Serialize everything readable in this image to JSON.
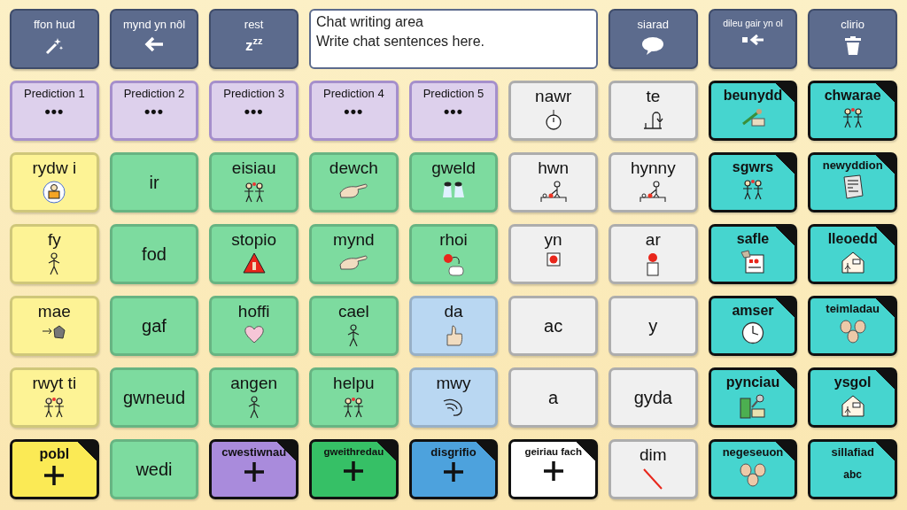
{
  "toolbar_left": [
    {
      "label": "ffon hud"
    },
    {
      "label": "mynd yn nôl"
    },
    {
      "label": "rest",
      "symbol": "z$^{z}$$^{z}$"
    }
  ],
  "chat": {
    "title": "Chat writing area",
    "placeholder": "Write chat sentences here."
  },
  "toolbar_right": [
    {
      "label": "siarad"
    },
    {
      "label": "dileu gair yn ol"
    },
    {
      "label": "clirio"
    }
  ],
  "grid": [
    [
      {
        "label": "Prediction 1",
        "kind": "prediction",
        "sub": "•••",
        "color": "#ddd0ec"
      },
      {
        "label": "Prediction 2",
        "kind": "prediction",
        "sub": "•••",
        "color": "#ddd0ec"
      },
      {
        "label": "Prediction 3",
        "kind": "prediction",
        "sub": "•••",
        "color": "#ddd0ec"
      },
      {
        "label": "Prediction 4",
        "kind": "prediction",
        "sub": "•••",
        "color": "#ddd0ec"
      },
      {
        "label": "Prediction 5",
        "kind": "prediction",
        "sub": "•••",
        "color": "#ddd0ec"
      },
      {
        "label": "nawr",
        "kind": "word",
        "color": "#f0f0f0"
      },
      {
        "label": "te",
        "kind": "word",
        "color": "#f0f0f0"
      },
      {
        "label": "beunydd",
        "kind": "folder",
        "color": "#46d5cf"
      },
      {
        "label": "chwarae",
        "kind": "folder",
        "color": "#46d5cf"
      }
    ],
    [
      {
        "label": "rydw i",
        "kind": "word",
        "color": "#fdf395"
      },
      {
        "label": "ir",
        "kind": "word",
        "color": "#7ddb9f"
      },
      {
        "label": "eisiau",
        "kind": "word",
        "color": "#7ddb9f"
      },
      {
        "label": "dewch",
        "kind": "word",
        "color": "#7ddb9f"
      },
      {
        "label": "gweld",
        "kind": "word",
        "color": "#7ddb9f"
      },
      {
        "label": "hwn",
        "kind": "word",
        "color": "#f0f0f0"
      },
      {
        "label": "hynny",
        "kind": "word",
        "color": "#f0f0f0"
      },
      {
        "label": "sgwrs",
        "kind": "folder",
        "color": "#46d5cf"
      },
      {
        "label": "newyddion",
        "kind": "folder",
        "color": "#46d5cf"
      }
    ],
    [
      {
        "label": "fy",
        "kind": "word",
        "color": "#fdf395"
      },
      {
        "label": "fod",
        "kind": "word",
        "color": "#7ddb9f"
      },
      {
        "label": "stopio",
        "kind": "word",
        "color": "#7ddb9f"
      },
      {
        "label": "mynd",
        "kind": "word",
        "color": "#7ddb9f"
      },
      {
        "label": "rhoi",
        "kind": "word",
        "color": "#7ddb9f"
      },
      {
        "label": "yn",
        "kind": "word",
        "color": "#f0f0f0"
      },
      {
        "label": "ar",
        "kind": "word",
        "color": "#f0f0f0"
      },
      {
        "label": "safle",
        "kind": "folder",
        "color": "#46d5cf"
      },
      {
        "label": "lleoedd",
        "kind": "folder",
        "color": "#46d5cf"
      }
    ],
    [
      {
        "label": "mae",
        "kind": "word",
        "color": "#fdf395"
      },
      {
        "label": "gaf",
        "kind": "word",
        "color": "#7ddb9f"
      },
      {
        "label": "hoffi",
        "kind": "word",
        "color": "#7ddb9f"
      },
      {
        "label": "cael",
        "kind": "word",
        "color": "#7ddb9f"
      },
      {
        "label": "da",
        "kind": "word",
        "color": "#b9d7f2"
      },
      {
        "label": "ac",
        "kind": "word",
        "color": "#f0f0f0"
      },
      {
        "label": "y",
        "kind": "word",
        "color": "#f0f0f0"
      },
      {
        "label": "amser",
        "kind": "folder",
        "color": "#46d5cf"
      },
      {
        "label": "teimladau",
        "kind": "folder",
        "color": "#46d5cf"
      }
    ],
    [
      {
        "label": "rwyt ti",
        "kind": "word",
        "color": "#fdf395"
      },
      {
        "label": "gwneud",
        "kind": "word",
        "color": "#7ddb9f"
      },
      {
        "label": "angen",
        "kind": "word",
        "color": "#7ddb9f"
      },
      {
        "label": "helpu",
        "kind": "word",
        "color": "#7ddb9f"
      },
      {
        "label": "mwy",
        "kind": "word",
        "color": "#b9d7f2"
      },
      {
        "label": "a",
        "kind": "word",
        "color": "#f0f0f0"
      },
      {
        "label": "gyda",
        "kind": "word",
        "color": "#f0f0f0"
      },
      {
        "label": "pynciau",
        "kind": "folder",
        "color": "#46d5cf"
      },
      {
        "label": "ysgol",
        "kind": "folder",
        "color": "#46d5cf"
      }
    ],
    [
      {
        "label": "pobl",
        "kind": "folder",
        "color": "#fbea55"
      },
      {
        "label": "wedi",
        "kind": "word",
        "color": "#7ddb9f"
      },
      {
        "label": "cwestiwnau",
        "kind": "folder",
        "color": "#a98bdc"
      },
      {
        "label": "gweithredau",
        "kind": "folder",
        "color": "#36c066"
      },
      {
        "label": "disgrifio",
        "kind": "folder",
        "color": "#4da2dd"
      },
      {
        "label": "geiriau fach",
        "kind": "folder",
        "color": "#ffffff"
      },
      {
        "label": "dim",
        "kind": "word",
        "color": "#f0f0f0"
      },
      {
        "label": "negeseuon",
        "kind": "folder",
        "color": "#46d5cf"
      },
      {
        "label": "sillafiad",
        "kind": "folder",
        "sub": "abc",
        "color": "#46d5cf"
      }
    ]
  ]
}
